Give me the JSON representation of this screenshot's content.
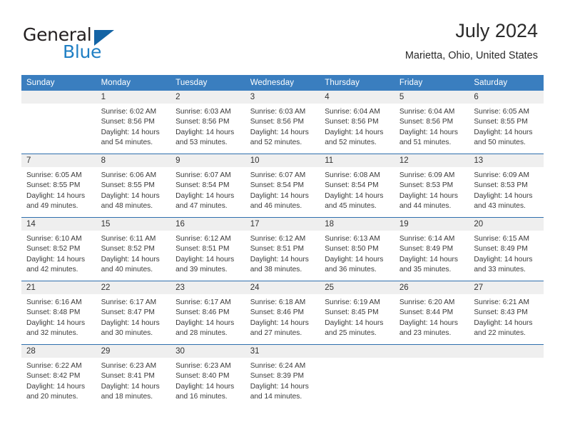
{
  "brand": {
    "name_part1": "General",
    "name_part2": "Blue",
    "logo_icon": "triangle-logo-icon",
    "accent_color": "#1f7fc4"
  },
  "header": {
    "title": "July 2024",
    "subtitle": "Marietta, Ohio, United States"
  },
  "calendar": {
    "header_bg_color": "#3a7ebf",
    "row_separator_color": "#2f6fad",
    "daynum_band_color": "#efefef",
    "weekday_headers": [
      "Sunday",
      "Monday",
      "Tuesday",
      "Wednesday",
      "Thursday",
      "Friday",
      "Saturday"
    ],
    "weeks": [
      [
        {
          "day": "",
          "empty": true,
          "sunrise": "",
          "sunset": "",
          "daylight_line1": "",
          "daylight_line2": ""
        },
        {
          "day": "1",
          "empty": false,
          "sunrise": "Sunrise: 6:02 AM",
          "sunset": "Sunset: 8:56 PM",
          "daylight_line1": "Daylight: 14 hours",
          "daylight_line2": "and 54 minutes."
        },
        {
          "day": "2",
          "empty": false,
          "sunrise": "Sunrise: 6:03 AM",
          "sunset": "Sunset: 8:56 PM",
          "daylight_line1": "Daylight: 14 hours",
          "daylight_line2": "and 53 minutes."
        },
        {
          "day": "3",
          "empty": false,
          "sunrise": "Sunrise: 6:03 AM",
          "sunset": "Sunset: 8:56 PM",
          "daylight_line1": "Daylight: 14 hours",
          "daylight_line2": "and 52 minutes."
        },
        {
          "day": "4",
          "empty": false,
          "sunrise": "Sunrise: 6:04 AM",
          "sunset": "Sunset: 8:56 PM",
          "daylight_line1": "Daylight: 14 hours",
          "daylight_line2": "and 52 minutes."
        },
        {
          "day": "5",
          "empty": false,
          "sunrise": "Sunrise: 6:04 AM",
          "sunset": "Sunset: 8:56 PM",
          "daylight_line1": "Daylight: 14 hours",
          "daylight_line2": "and 51 minutes."
        },
        {
          "day": "6",
          "empty": false,
          "sunrise": "Sunrise: 6:05 AM",
          "sunset": "Sunset: 8:55 PM",
          "daylight_line1": "Daylight: 14 hours",
          "daylight_line2": "and 50 minutes."
        }
      ],
      [
        {
          "day": "7",
          "empty": false,
          "sunrise": "Sunrise: 6:05 AM",
          "sunset": "Sunset: 8:55 PM",
          "daylight_line1": "Daylight: 14 hours",
          "daylight_line2": "and 49 minutes."
        },
        {
          "day": "8",
          "empty": false,
          "sunrise": "Sunrise: 6:06 AM",
          "sunset": "Sunset: 8:55 PM",
          "daylight_line1": "Daylight: 14 hours",
          "daylight_line2": "and 48 minutes."
        },
        {
          "day": "9",
          "empty": false,
          "sunrise": "Sunrise: 6:07 AM",
          "sunset": "Sunset: 8:54 PM",
          "daylight_line1": "Daylight: 14 hours",
          "daylight_line2": "and 47 minutes."
        },
        {
          "day": "10",
          "empty": false,
          "sunrise": "Sunrise: 6:07 AM",
          "sunset": "Sunset: 8:54 PM",
          "daylight_line1": "Daylight: 14 hours",
          "daylight_line2": "and 46 minutes."
        },
        {
          "day": "11",
          "empty": false,
          "sunrise": "Sunrise: 6:08 AM",
          "sunset": "Sunset: 8:54 PM",
          "daylight_line1": "Daylight: 14 hours",
          "daylight_line2": "and 45 minutes."
        },
        {
          "day": "12",
          "empty": false,
          "sunrise": "Sunrise: 6:09 AM",
          "sunset": "Sunset: 8:53 PM",
          "daylight_line1": "Daylight: 14 hours",
          "daylight_line2": "and 44 minutes."
        },
        {
          "day": "13",
          "empty": false,
          "sunrise": "Sunrise: 6:09 AM",
          "sunset": "Sunset: 8:53 PM",
          "daylight_line1": "Daylight: 14 hours",
          "daylight_line2": "and 43 minutes."
        }
      ],
      [
        {
          "day": "14",
          "empty": false,
          "sunrise": "Sunrise: 6:10 AM",
          "sunset": "Sunset: 8:52 PM",
          "daylight_line1": "Daylight: 14 hours",
          "daylight_line2": "and 42 minutes."
        },
        {
          "day": "15",
          "empty": false,
          "sunrise": "Sunrise: 6:11 AM",
          "sunset": "Sunset: 8:52 PM",
          "daylight_line1": "Daylight: 14 hours",
          "daylight_line2": "and 40 minutes."
        },
        {
          "day": "16",
          "empty": false,
          "sunrise": "Sunrise: 6:12 AM",
          "sunset": "Sunset: 8:51 PM",
          "daylight_line1": "Daylight: 14 hours",
          "daylight_line2": "and 39 minutes."
        },
        {
          "day": "17",
          "empty": false,
          "sunrise": "Sunrise: 6:12 AM",
          "sunset": "Sunset: 8:51 PM",
          "daylight_line1": "Daylight: 14 hours",
          "daylight_line2": "and 38 minutes."
        },
        {
          "day": "18",
          "empty": false,
          "sunrise": "Sunrise: 6:13 AM",
          "sunset": "Sunset: 8:50 PM",
          "daylight_line1": "Daylight: 14 hours",
          "daylight_line2": "and 36 minutes."
        },
        {
          "day": "19",
          "empty": false,
          "sunrise": "Sunrise: 6:14 AM",
          "sunset": "Sunset: 8:49 PM",
          "daylight_line1": "Daylight: 14 hours",
          "daylight_line2": "and 35 minutes."
        },
        {
          "day": "20",
          "empty": false,
          "sunrise": "Sunrise: 6:15 AM",
          "sunset": "Sunset: 8:49 PM",
          "daylight_line1": "Daylight: 14 hours",
          "daylight_line2": "and 33 minutes."
        }
      ],
      [
        {
          "day": "21",
          "empty": false,
          "sunrise": "Sunrise: 6:16 AM",
          "sunset": "Sunset: 8:48 PM",
          "daylight_line1": "Daylight: 14 hours",
          "daylight_line2": "and 32 minutes."
        },
        {
          "day": "22",
          "empty": false,
          "sunrise": "Sunrise: 6:17 AM",
          "sunset": "Sunset: 8:47 PM",
          "daylight_line1": "Daylight: 14 hours",
          "daylight_line2": "and 30 minutes."
        },
        {
          "day": "23",
          "empty": false,
          "sunrise": "Sunrise: 6:17 AM",
          "sunset": "Sunset: 8:46 PM",
          "daylight_line1": "Daylight: 14 hours",
          "daylight_line2": "and 28 minutes."
        },
        {
          "day": "24",
          "empty": false,
          "sunrise": "Sunrise: 6:18 AM",
          "sunset": "Sunset: 8:46 PM",
          "daylight_line1": "Daylight: 14 hours",
          "daylight_line2": "and 27 minutes."
        },
        {
          "day": "25",
          "empty": false,
          "sunrise": "Sunrise: 6:19 AM",
          "sunset": "Sunset: 8:45 PM",
          "daylight_line1": "Daylight: 14 hours",
          "daylight_line2": "and 25 minutes."
        },
        {
          "day": "26",
          "empty": false,
          "sunrise": "Sunrise: 6:20 AM",
          "sunset": "Sunset: 8:44 PM",
          "daylight_line1": "Daylight: 14 hours",
          "daylight_line2": "and 23 minutes."
        },
        {
          "day": "27",
          "empty": false,
          "sunrise": "Sunrise: 6:21 AM",
          "sunset": "Sunset: 8:43 PM",
          "daylight_line1": "Daylight: 14 hours",
          "daylight_line2": "and 22 minutes."
        }
      ],
      [
        {
          "day": "28",
          "empty": false,
          "sunrise": "Sunrise: 6:22 AM",
          "sunset": "Sunset: 8:42 PM",
          "daylight_line1": "Daylight: 14 hours",
          "daylight_line2": "and 20 minutes."
        },
        {
          "day": "29",
          "empty": false,
          "sunrise": "Sunrise: 6:23 AM",
          "sunset": "Sunset: 8:41 PM",
          "daylight_line1": "Daylight: 14 hours",
          "daylight_line2": "and 18 minutes."
        },
        {
          "day": "30",
          "empty": false,
          "sunrise": "Sunrise: 6:23 AM",
          "sunset": "Sunset: 8:40 PM",
          "daylight_line1": "Daylight: 14 hours",
          "daylight_line2": "and 16 minutes."
        },
        {
          "day": "31",
          "empty": false,
          "sunrise": "Sunrise: 6:24 AM",
          "sunset": "Sunset: 8:39 PM",
          "daylight_line1": "Daylight: 14 hours",
          "daylight_line2": "and 14 minutes."
        },
        {
          "day": "",
          "empty": true,
          "sunrise": "",
          "sunset": "",
          "daylight_line1": "",
          "daylight_line2": ""
        },
        {
          "day": "",
          "empty": true,
          "sunrise": "",
          "sunset": "",
          "daylight_line1": "",
          "daylight_line2": ""
        },
        {
          "day": "",
          "empty": true,
          "sunrise": "",
          "sunset": "",
          "daylight_line1": "",
          "daylight_line2": ""
        }
      ]
    ]
  }
}
